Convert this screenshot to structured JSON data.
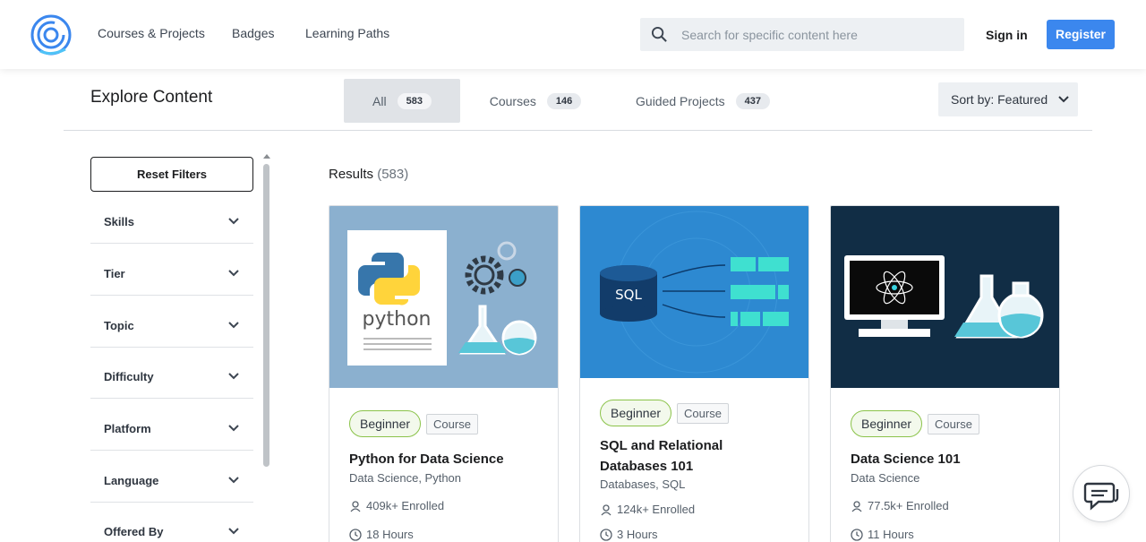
{
  "nav": {
    "links": [
      "Courses & Projects",
      "Badges",
      "Learning Paths"
    ],
    "search_placeholder": "Search for specific content here",
    "signin": "Sign in",
    "register": "Register"
  },
  "explore": {
    "title": "Explore Content",
    "tabs": [
      {
        "label": "All",
        "count": "583"
      },
      {
        "label": "Courses",
        "count": "146"
      },
      {
        "label": "Guided Projects",
        "count": "437"
      }
    ],
    "sort": "Sort by: Featured"
  },
  "sidebar": {
    "reset": "Reset Filters",
    "filters": [
      "Skills",
      "Tier",
      "Topic",
      "Difficulty",
      "Platform",
      "Language",
      "Offered By"
    ]
  },
  "results": {
    "label": "Results",
    "count": "(583)"
  },
  "cards": [
    {
      "level": "Beginner",
      "type": "Course",
      "title": "Python for Data Science",
      "tags": "Data Science, Python",
      "enrolled": "409k+ Enrolled",
      "duration": "18 Hours",
      "image_text": "python"
    },
    {
      "level": "Beginner",
      "type": "Course",
      "title": "SQL and Relational Databases 101",
      "tags": "Databases, SQL",
      "enrolled": "124k+ Enrolled",
      "duration": "3 Hours",
      "image_text": "SQL"
    },
    {
      "level": "Beginner",
      "type": "Course",
      "title": "Data Science 101",
      "tags": "Data Science",
      "enrolled": "77.5k+ Enrolled",
      "duration": "11 Hours"
    }
  ],
  "colors": {
    "accent": "#3b87ee",
    "beginner_border": "#8bc34a",
    "card1_bg": "#8bb0cf",
    "card2_bg": "#2d89d1",
    "card3_bg": "#112d45"
  }
}
